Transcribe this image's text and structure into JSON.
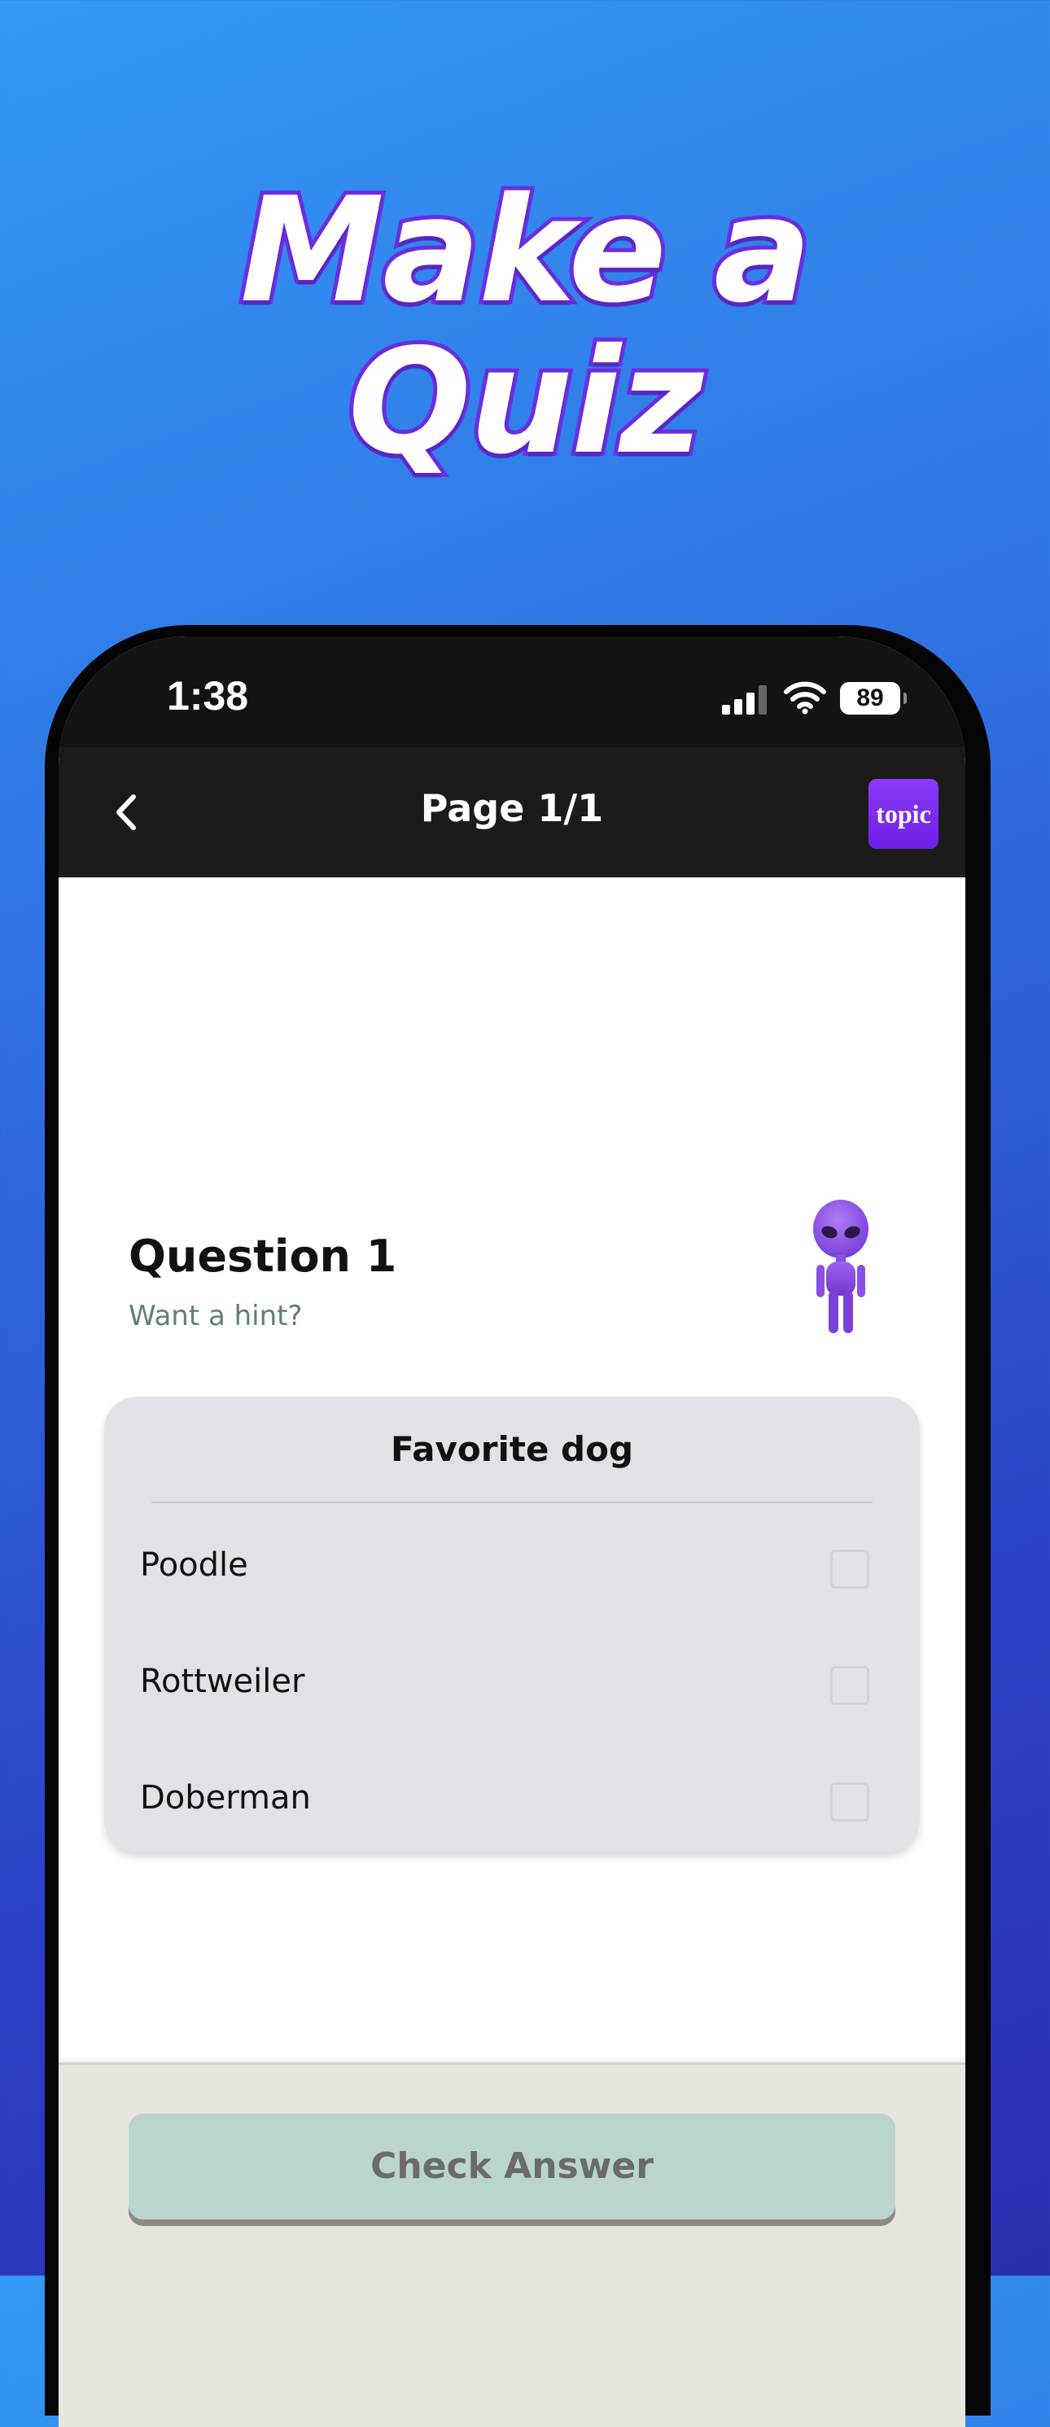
{
  "headline": {
    "line1": "Make a",
    "line2": "Quiz"
  },
  "status_bar": {
    "time": "1:38",
    "battery": "89",
    "icons": [
      "signal-icon",
      "wifi-icon",
      "battery-icon"
    ]
  },
  "nav": {
    "back_icon": "chevron-left-icon",
    "title": "Page 1/1",
    "topic_label": "topic"
  },
  "question": {
    "title": "Question 1",
    "hint": "Want a hint?",
    "mascot_icon": "alien-icon"
  },
  "card": {
    "title": "Favorite dog",
    "options": [
      {
        "label": "Poodle",
        "checked": false
      },
      {
        "label": "Rottweiler",
        "checked": false
      },
      {
        "label": "Doberman",
        "checked": false
      }
    ]
  },
  "footer": {
    "check_answer_label": "Check Answer"
  },
  "colors": {
    "background_gradient_start": "#3398f5",
    "background_gradient_end": "#2a2eae",
    "headline_stroke": "#6a2ee0",
    "topic_button": "#7a2af0",
    "hint_text": "#5e7f7a",
    "card_background": "#e0e2e7",
    "check_button": "#bad5cf"
  }
}
